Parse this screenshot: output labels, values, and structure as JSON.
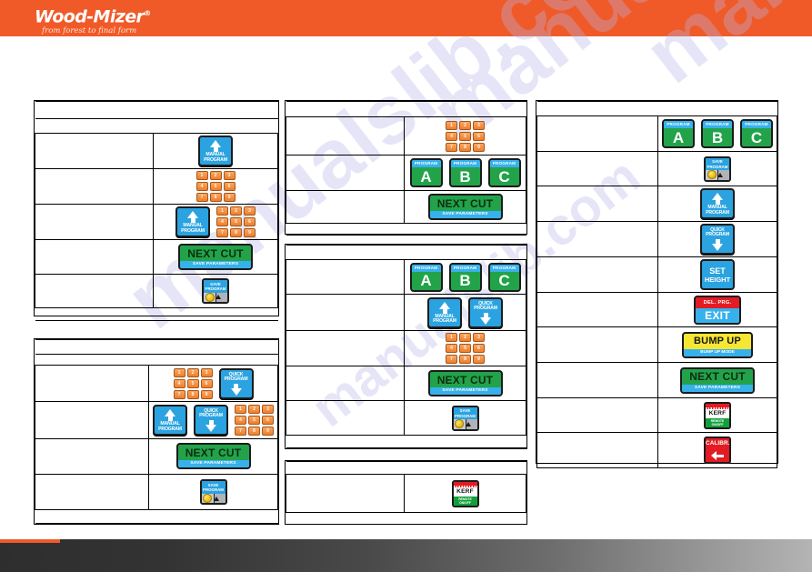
{
  "brand": {
    "name": "Wood-Mizer",
    "registered": "®",
    "tagline": "from forest to final form",
    "banner_color": "#f05a28"
  },
  "watermark": {
    "text_a": "manualslib.com",
    "text_b": "manualslib.com",
    "text_c": "manualslib.com",
    "text_d": "manualslib.com",
    "color": "#b9b5ea"
  },
  "icons": {
    "arrow_up": "arrow-up-icon",
    "arrow_down": "arrow-down-icon",
    "disk": "floppy-disk-icon",
    "blade": "saw-blade-icon"
  },
  "buttons": {
    "manual_program": {
      "label_line1": "MANUAL",
      "label_line2": "PROGRAM",
      "color": "#2aa3e0"
    },
    "quick_program": {
      "label_line1": "QUICK",
      "label_line2": "PROGRAM",
      "color": "#2aa3e0"
    },
    "next_cut": {
      "main": "NEXT CUT",
      "sub": "SAVE PARAMETERS",
      "color": "#22a34a",
      "sub_color": "#37b1ec"
    },
    "save_program": {
      "label_line1": "SAVE",
      "label_line2": "PROGRAM",
      "color": "#2aa3e0"
    },
    "program_a": {
      "top": "PROGRAM",
      "big": "A",
      "color": "#22a34a"
    },
    "program_b": {
      "top": "PROGRAM",
      "big": "B",
      "color": "#22a34a"
    },
    "program_c": {
      "top": "PROGRAM",
      "big": "C",
      "color": "#22a34a"
    },
    "set_height": {
      "line1": "SET",
      "line2": "HEIGHT",
      "color": "#2aa3e0"
    },
    "exit": {
      "top": "DEL. PRG.",
      "bottom": "EXIT",
      "top_color": "#e31b23",
      "bottom_color": "#37b1ec"
    },
    "bump_up": {
      "main": "BUMP UP",
      "sub": "BUMP UP MODE",
      "color": "#f7e733",
      "sub_color": "#37b1ec"
    },
    "kerf": {
      "main": "KERF",
      "sub_line1": "REMOTE",
      "sub_line2": "ON/OFF",
      "top_color": "#e31b23",
      "bottom_color": "#13a03c"
    },
    "calibr": {
      "top": "CALIBR.",
      "top_color": "#e31b23"
    }
  },
  "keypad": {
    "keys": [
      "1",
      "2",
      "3",
      "4",
      "5",
      "6",
      "7",
      "8",
      "9"
    ]
  },
  "tables": {
    "t1": {
      "title": "",
      "subtitle": "",
      "rows": [
        {
          "text": "",
          "art": "manual-program"
        },
        {
          "text": "",
          "art": "numpad"
        },
        {
          "text": "",
          "art": "manual-program-numpad"
        },
        {
          "text": "",
          "art": "next-cut"
        },
        {
          "text": "",
          "art": "save-program"
        }
      ],
      "footer": ""
    },
    "t2": {
      "title": "",
      "subtitle": "",
      "rows": [
        {
          "text": "",
          "art": "numpad-quick-program"
        },
        {
          "text": "",
          "art": "manual-quick-numpad"
        },
        {
          "text": "",
          "art": "next-cut"
        },
        {
          "text": "",
          "art": "save-program"
        }
      ],
      "footer": ""
    },
    "t3": {
      "title": "",
      "rows": [
        {
          "text": "",
          "art": "numpad"
        },
        {
          "text": "",
          "art": "program-abc"
        },
        {
          "text": "",
          "art": "next-cut"
        }
      ],
      "footer": ""
    },
    "t4": {
      "title": "",
      "rows": [
        {
          "text": "",
          "art": "program-abc"
        },
        {
          "text": "",
          "art": "manual-quick"
        },
        {
          "text": "",
          "art": "numpad"
        },
        {
          "text": "",
          "art": "next-cut"
        },
        {
          "text": "",
          "art": "save-program"
        }
      ],
      "footer": ""
    },
    "t5": {
      "title": "",
      "rows": [
        {
          "text": "",
          "art": "kerf"
        }
      ],
      "footer": ""
    },
    "t6": {
      "title": "",
      "rows": [
        {
          "text": "",
          "art": "program-abc"
        },
        {
          "text": "",
          "art": "save-program"
        },
        {
          "text": "",
          "art": "manual-program"
        },
        {
          "text": "",
          "art": "quick-program"
        },
        {
          "text": "",
          "art": "set-height"
        },
        {
          "text": "",
          "art": "exit"
        },
        {
          "text": "",
          "art": "bump-up"
        },
        {
          "text": "",
          "art": "next-cut"
        },
        {
          "text": "",
          "art": "kerf"
        },
        {
          "text": "",
          "art": "calibr"
        }
      ],
      "footer": ""
    }
  }
}
